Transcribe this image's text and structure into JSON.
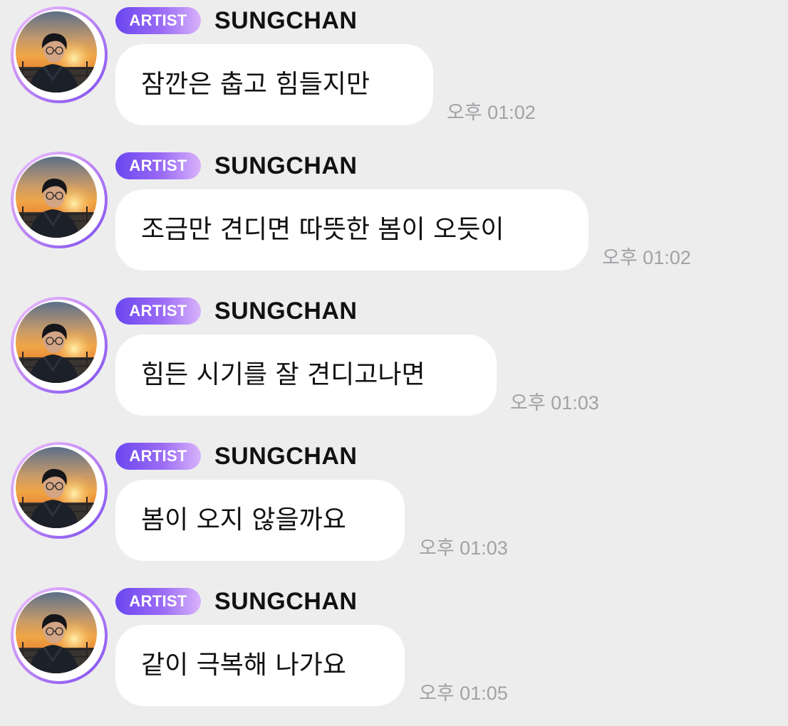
{
  "messages": [
    {
      "badge": "ARTIST",
      "sender": "SUNGCHAN",
      "text": "잠깐은 춥고 힘들지만",
      "time": "오후 01:02"
    },
    {
      "badge": "ARTIST",
      "sender": "SUNGCHAN",
      "text": "조금만 견디면 따뜻한 봄이 오듯이",
      "time": "오후 01:02"
    },
    {
      "badge": "ARTIST",
      "sender": "SUNGCHAN",
      "text": "힘든 시기를 잘 견디고나면",
      "time": "오후 01:03"
    },
    {
      "badge": "ARTIST",
      "sender": "SUNGCHAN",
      "text": "봄이 오지 않을까요",
      "time": "오후 01:03"
    },
    {
      "badge": "ARTIST",
      "sender": "SUNGCHAN",
      "text": "같이 극복해 나가요",
      "time": "오후 01:05"
    }
  ],
  "colors": {
    "background": "#ededee",
    "bubble": "#ffffff",
    "badge_start": "#6b46f0",
    "badge_end": "#d9b2fb",
    "timestamp": "#a2a2a6"
  },
  "icons": {
    "avatar": "profile-photo-sunset"
  }
}
